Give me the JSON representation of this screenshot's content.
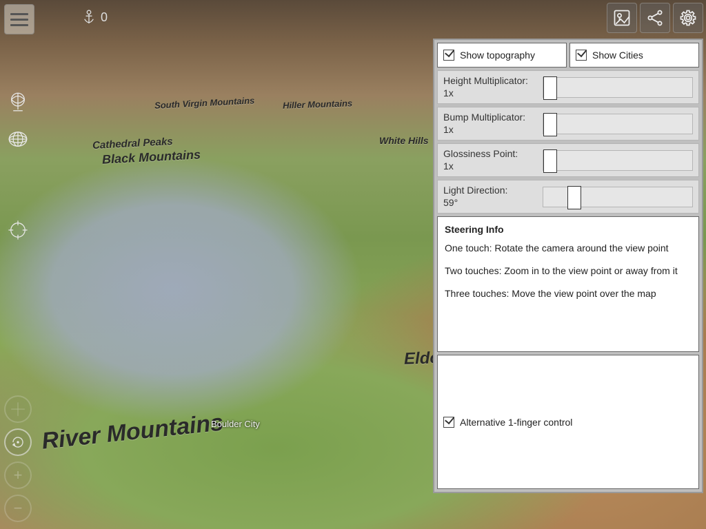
{
  "anchor_value": "0",
  "map_labels": {
    "south_virgin": "South Virgin Mountains",
    "hiller": "Hiller Mountains",
    "cathedral": "Cathedral Peaks",
    "black_mtns": "Black Mountains",
    "white_hills": "White Hills",
    "river_mtns": "River Mountains",
    "eldorado": "Eldorado",
    "boulder_city": "Boulder City"
  },
  "panel": {
    "show_topography": {
      "label": "Show topography",
      "checked": true
    },
    "show_cities": {
      "label": "Show Cities",
      "checked": true
    },
    "sliders": {
      "height": {
        "label": "Height Multiplicator:",
        "value": "1x",
        "pos_pct": 0
      },
      "bump": {
        "label": "Bump Multiplicator:",
        "value": "1x",
        "pos_pct": 0
      },
      "gloss": {
        "label": "Glossiness Point:",
        "value": "1x",
        "pos_pct": 0
      },
      "light": {
        "label": "Light Direction:",
        "value": "59°",
        "pos_pct": 16
      }
    },
    "info": {
      "heading": "Steering Info",
      "one": "One touch: Rotate the camera around the view point",
      "two": "Two touches: Zoom in to the view point or away from it",
      "three": "Three touches: Move the view point over the map"
    },
    "alt_control": {
      "label": "Alternative 1-finger control",
      "checked": true
    }
  }
}
